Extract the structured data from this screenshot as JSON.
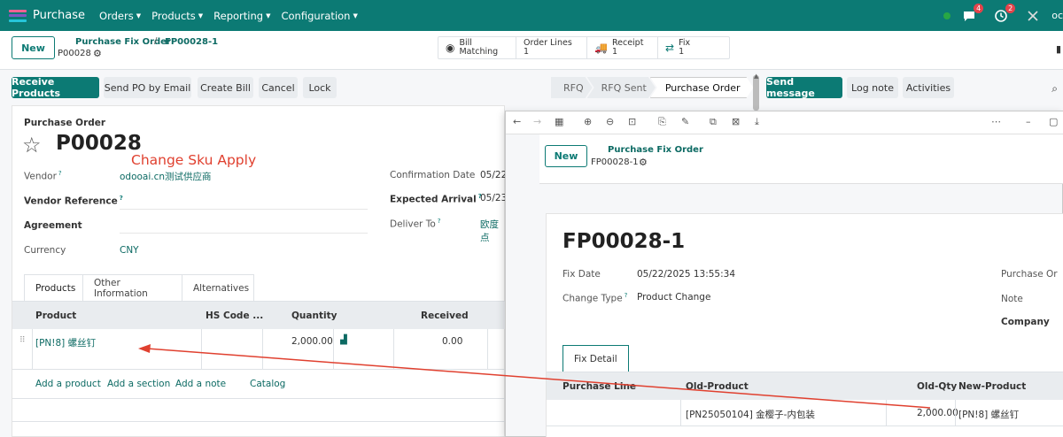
{
  "navbar": {
    "app_name": "Purchase",
    "menus": [
      "Orders",
      "Products",
      "Reporting",
      "Configuration"
    ],
    "chat_count": "4",
    "activity_count": "2",
    "user_initial": "oc",
    "colors": {
      "navbar": "#0c7a74",
      "accent": "#0c7a74",
      "badge": "#e4434b"
    }
  },
  "control": {
    "new_label": "New",
    "breadcrumb_parent": "Purchase Fix Order",
    "breadcrumb_current": "FP00028-1",
    "record_name": "P00028",
    "smart_buttons": [
      {
        "label": "Bill Matching",
        "count": ""
      },
      {
        "label": "Order Lines",
        "count": "1"
      },
      {
        "label": "Receipt",
        "count": "1"
      },
      {
        "label": "Fix",
        "count": "1"
      }
    ]
  },
  "actions": {
    "buttons": [
      "Receive Products",
      "Send PO by Email",
      "Create Bill",
      "Cancel",
      "Lock"
    ],
    "statuses": [
      "RFQ",
      "RFQ Sent",
      "Purchase Order"
    ],
    "active_status": "Purchase Order",
    "chatter": [
      "Send message",
      "Log note",
      "Activities"
    ]
  },
  "form": {
    "subtitle": "Purchase Order",
    "title": "P00028",
    "vendor_label": "Vendor",
    "vendor_value": "odooai.cn测试供应商",
    "vendor_ref_label": "Vendor Reference",
    "agreement_label": "Agreement",
    "currency_label": "Currency",
    "currency_value": "CNY",
    "confirmation_label": "Confirmation Date",
    "confirmation_value": "05/22",
    "expected_label": "Expected Arrival",
    "expected_value": "05/23",
    "deliver_label": "Deliver To",
    "deliver_value": "欧度点",
    "annotation": "Change Sku Apply",
    "tabs": [
      "Products",
      "Other Information",
      "Alternatives"
    ],
    "columns": [
      "Product",
      "HS Code ...",
      "Quantity",
      "Received"
    ],
    "line": {
      "product": "[PN!8] 螺丝钉",
      "quantity": "2,000.00",
      "received": "0.00"
    },
    "add_links": [
      "Add a product",
      "Add a section",
      "Add a note",
      "Catalog"
    ]
  },
  "popup": {
    "new_label": "New",
    "breadcrumb": "Purchase Fix Order",
    "record_name": "FP00028-1",
    "title": "FP00028-1",
    "fix_date_label": "Fix Date",
    "fix_date_value": "05/22/2025 13:55:34",
    "change_type_label": "Change Type",
    "change_type_value": "Product Change",
    "purchase_order_label": "Purchase Or",
    "note_label": "Note",
    "company_label": "Company",
    "tab": "Fix Detail",
    "columns": [
      "Purchase Line",
      "Old-Product",
      "Old-Qty",
      "New-Product"
    ],
    "row": {
      "old_product": "[PN25050104] 金樱子-内包装",
      "old_qty": "2,000.00",
      "new_product": "[PN!8] 螺丝钉"
    }
  }
}
